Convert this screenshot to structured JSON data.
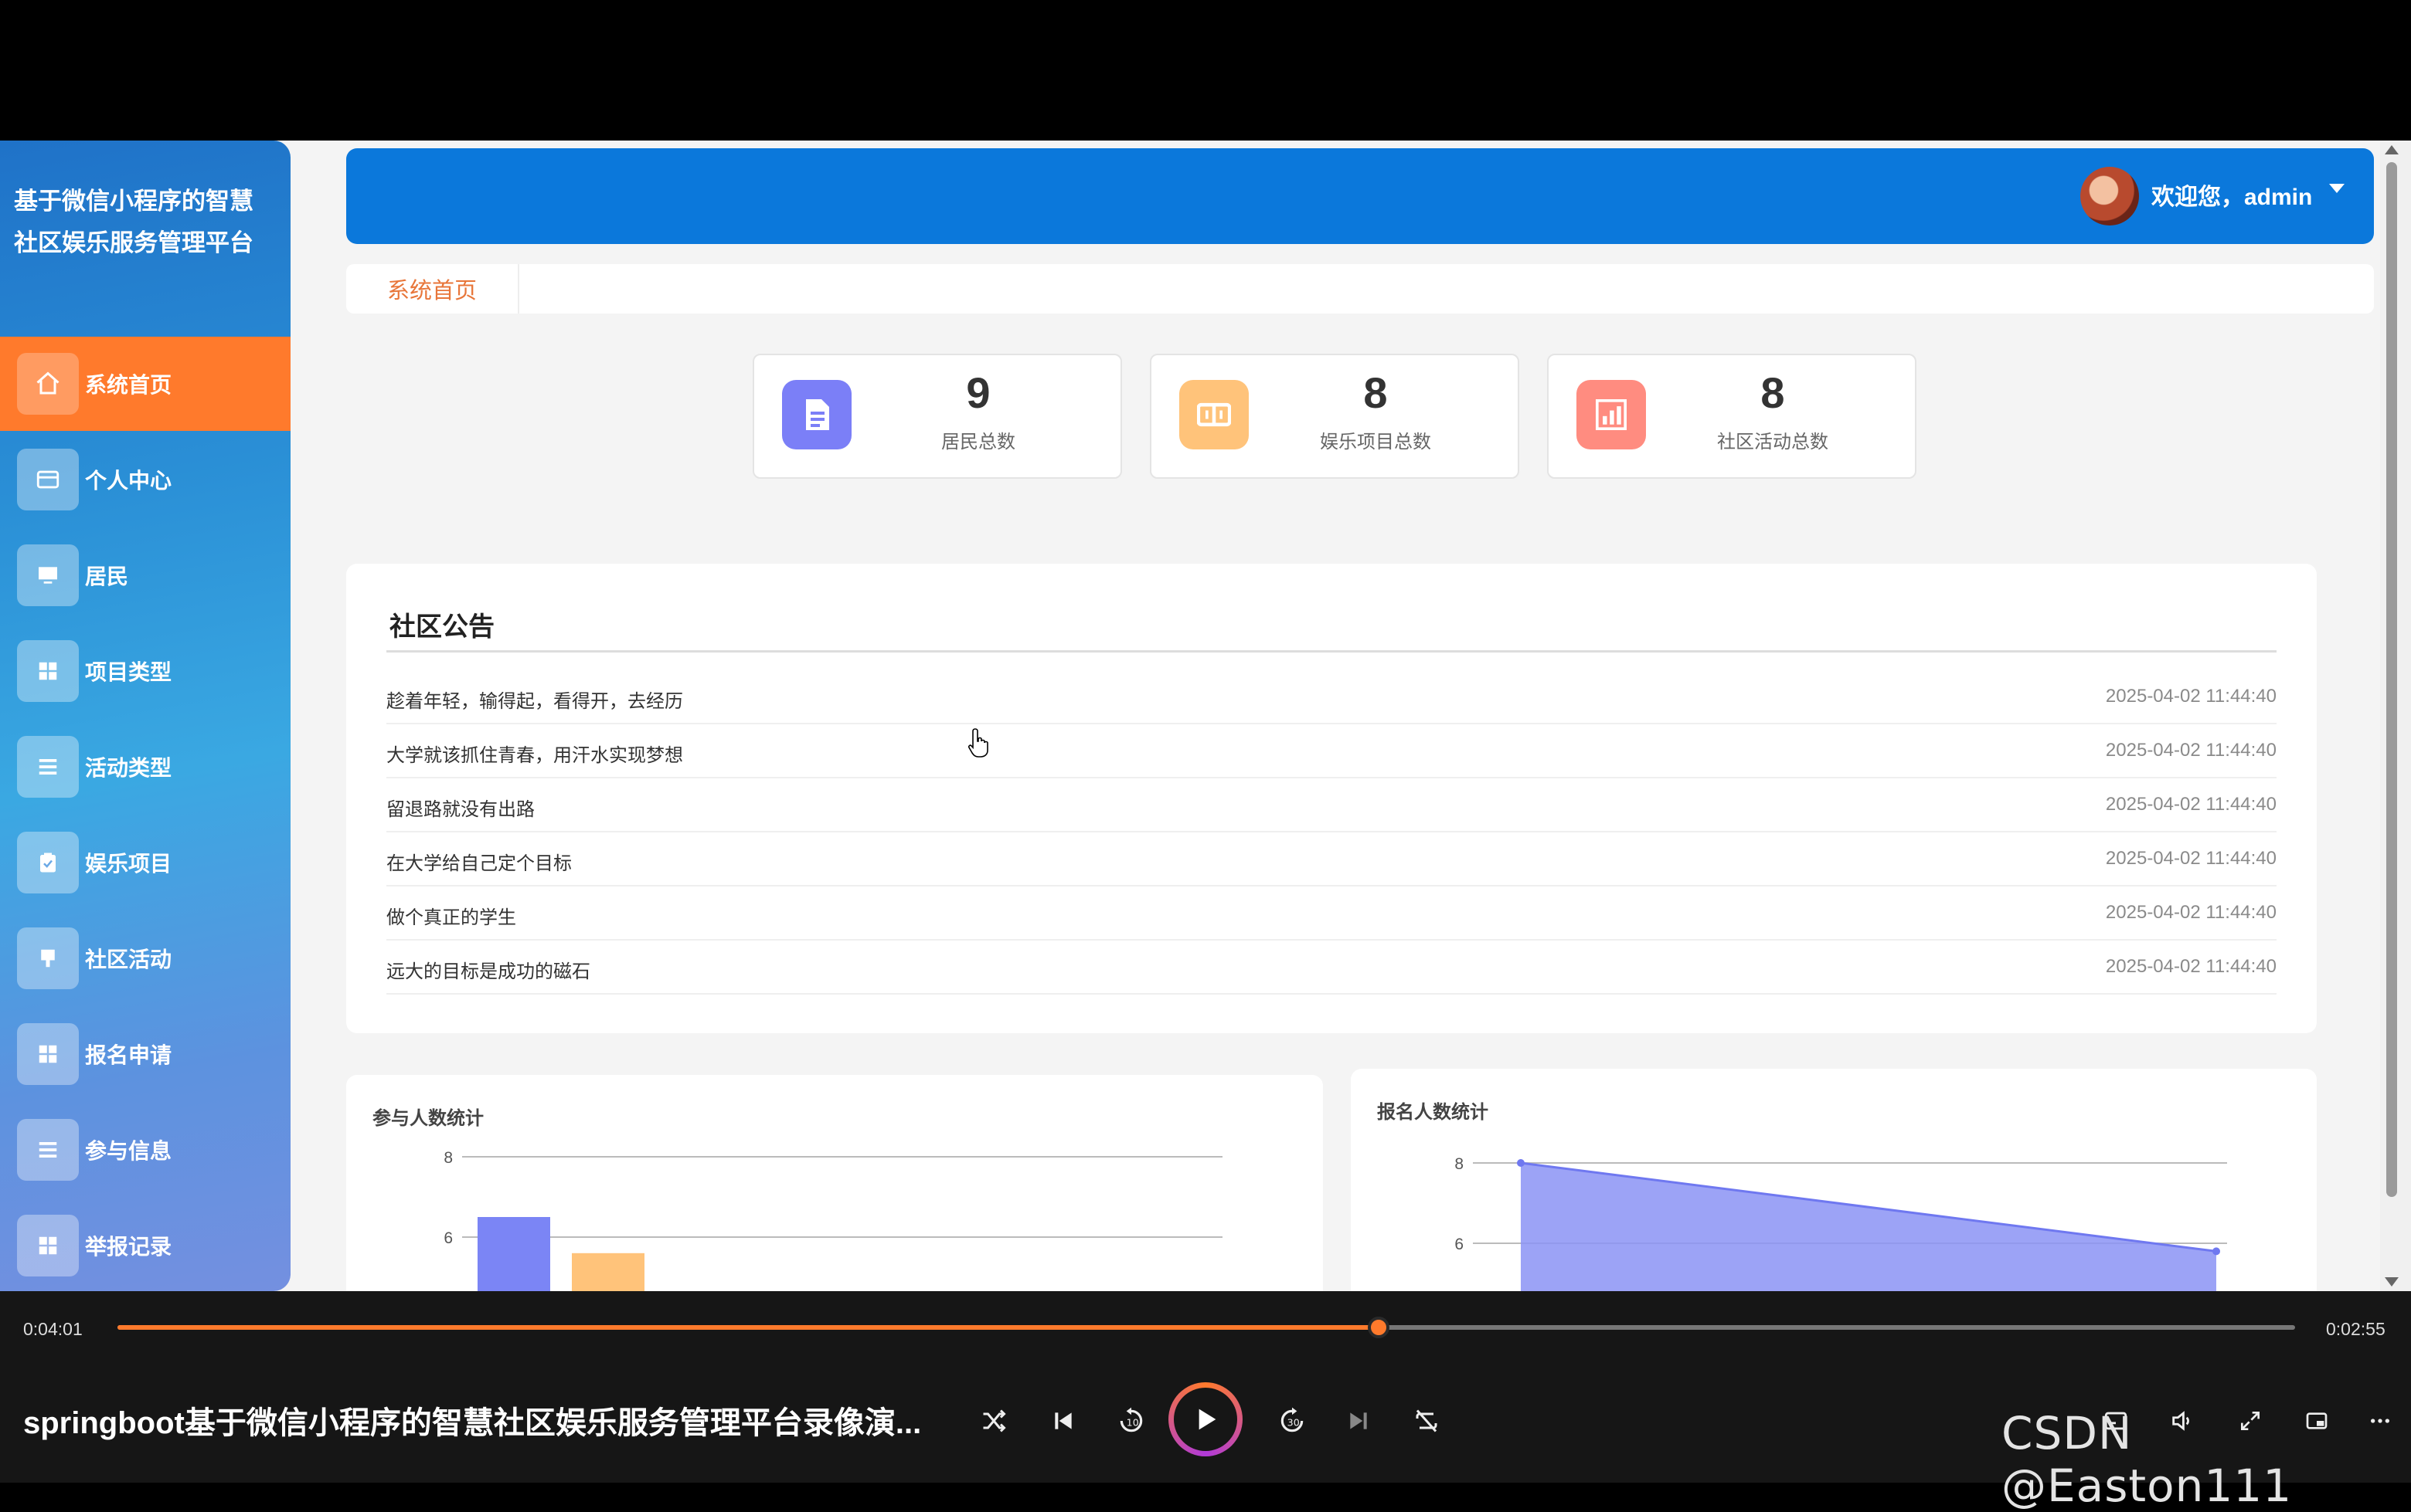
{
  "sidebar": {
    "brand": "基于微信小程序的智慧社区娱乐服务管理平台",
    "items": [
      {
        "label": "系统首页",
        "icon": "home-icon",
        "active": true
      },
      {
        "label": "个人中心",
        "icon": "card-icon"
      },
      {
        "label": "居民",
        "icon": "monitor-icon"
      },
      {
        "label": "项目类型",
        "icon": "grid-icon"
      },
      {
        "label": "活动类型",
        "icon": "list-icon"
      },
      {
        "label": "娱乐项目",
        "icon": "clipboard-icon"
      },
      {
        "label": "社区活动",
        "icon": "flag-icon"
      },
      {
        "label": "报名申请",
        "icon": "grid-icon"
      },
      {
        "label": "参与信息",
        "icon": "list-icon"
      },
      {
        "label": "举报记录",
        "icon": "grid-icon"
      }
    ]
  },
  "header": {
    "welcome": "欢迎您，admin"
  },
  "breadcrumb": {
    "tab": "系统首页"
  },
  "stats": [
    {
      "value": "9",
      "label": "居民总数",
      "color": "#7b7ff7",
      "icon": "document-icon"
    },
    {
      "value": "8",
      "label": "娱乐项目总数",
      "color": "#ffc37a",
      "icon": "book-icon"
    },
    {
      "value": "8",
      "label": "社区活动总数",
      "color": "#ff8c80",
      "icon": "chart-icon"
    }
  ],
  "notice": {
    "title": "社区公告",
    "rows": [
      {
        "text": "趁着年轻，输得起，看得开，去经历",
        "date": "2025-04-02 11:44:40"
      },
      {
        "text": "大学就该抓住青春，用汗水实现梦想",
        "date": "2025-04-02 11:44:40"
      },
      {
        "text": "留退路就没有出路",
        "date": "2025-04-02 11:44:40"
      },
      {
        "text": "在大学给自己定个目标",
        "date": "2025-04-02 11:44:40"
      },
      {
        "text": "做个真正的学生",
        "date": "2025-04-02 11:44:40"
      },
      {
        "text": "远大的目标是成功的磁石",
        "date": "2025-04-02 11:44:40"
      }
    ]
  },
  "chart_data": [
    {
      "type": "bar",
      "title": "参与人数统计",
      "yticks": [
        "8",
        "6"
      ],
      "ylim": [
        0,
        8
      ],
      "grid": true,
      "series": [
        {
          "values": [
            6.5
          ],
          "color": "#7b85f5"
        },
        {
          "values": [
            5.6
          ],
          "color": "#ffc37a"
        }
      ]
    },
    {
      "type": "area",
      "title": "报名人数统计",
      "yticks": [
        "8",
        "6"
      ],
      "ylim": [
        0,
        8
      ],
      "grid": true,
      "series": [
        {
          "values": [
            8,
            5.8
          ],
          "color": "#8b93f5"
        }
      ]
    }
  ],
  "player": {
    "current_time": "0:04:01",
    "total_time": "0:02:55",
    "progress": 0.579,
    "title": "springboot基于微信小程序的智慧社区娱乐服务管理平台录像演...",
    "watermark": "CSDN @Easton111",
    "accent": "#ff7a2c"
  }
}
